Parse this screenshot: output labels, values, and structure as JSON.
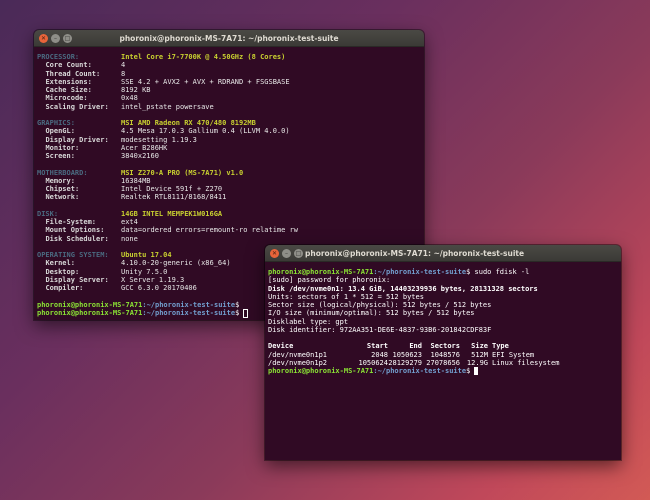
{
  "window1": {
    "title": "phoronix@phoronix-MS-7A71: ~/phoronix-test-suite",
    "sections": [
      {
        "label": "PROCESSOR:",
        "value": "Intel Core i7-7700K @ 4.50GHz (8 Cores)",
        "items": [
          {
            "key": "Core Count:",
            "value": "4"
          },
          {
            "key": "Thread Count:",
            "value": "8"
          },
          {
            "key": "Extensions:",
            "value": "SSE 4.2 + AVX2 + AVX + RDRAND + FSGSBASE"
          },
          {
            "key": "Cache Size:",
            "value": "8192 KB"
          },
          {
            "key": "Microcode:",
            "value": "0x48"
          },
          {
            "key": "Scaling Driver:",
            "value": "intel_pstate powersave"
          }
        ]
      },
      {
        "label": "GRAPHICS:",
        "value": "MSI AMD Radeon RX 470/480 8192MB",
        "items": [
          {
            "key": "OpenGL:",
            "value": "4.5 Mesa 17.0.3 Gallium 0.4 (LLVM 4.0.0)"
          },
          {
            "key": "Display Driver:",
            "value": "modesetting 1.19.3"
          },
          {
            "key": "Monitor:",
            "value": "Acer B286HK"
          },
          {
            "key": "Screen:",
            "value": "3840x2160"
          }
        ]
      },
      {
        "label": "MOTHERBOARD:",
        "value": "MSI Z270-A PRO (MS-7A71) v1.0",
        "items": [
          {
            "key": "Memory:",
            "value": "16384MB"
          },
          {
            "key": "Chipset:",
            "value": "Intel Device 591f + Z270"
          },
          {
            "key": "Network:",
            "value": "Realtek RTL8111/8168/8411"
          }
        ]
      },
      {
        "label": "DISK:",
        "value": "14GB INTEL MEMPEK1W016GA",
        "items": [
          {
            "key": "File-System:",
            "value": "ext4"
          },
          {
            "key": "Mount Options:",
            "value": "data=ordered errors=remount-ro relatime rw"
          },
          {
            "key": "Disk Scheduler:",
            "value": "none"
          }
        ]
      },
      {
        "label": "OPERATING SYSTEM:",
        "value": "Ubuntu 17.04",
        "items": [
          {
            "key": "Kernel:",
            "value": "4.10.0-20-generic (x86_64)"
          },
          {
            "key": "Desktop:",
            "value": "Unity 7.5.0"
          },
          {
            "key": "Display Server:",
            "value": "X Server 1.19.3"
          },
          {
            "key": "Compiler:",
            "value": "GCC 6.3.0 20170406"
          }
        ]
      }
    ],
    "prompt_user": "phoronix@phoronix-MS-7A71",
    "prompt_path": ":~/phoronix-test-suite",
    "prompt_symbol": "$"
  },
  "window2": {
    "title": "phoronix@phoronix-MS-7A71: ~/phoronix-test-suite",
    "prompt_user": "phoronix@phoronix-MS-7A71",
    "prompt_path": ":~/phoronix-test-suite",
    "prompt_symbol": "$",
    "command": " sudo fdisk -l",
    "lines": [
      {
        "text": "[sudo] password for phoronix:",
        "bold": false
      },
      {
        "text": "Disk /dev/nvme0n1: 13.4 GiB, 14403239936 bytes, 28131328 sectors",
        "bold": true
      },
      {
        "text": "Units: sectors of 1 * 512 = 512 bytes",
        "bold": false
      },
      {
        "text": "Sector size (logical/physical): 512 bytes / 512 bytes",
        "bold": false
      },
      {
        "text": "I/O size (minimum/optimal): 512 bytes / 512 bytes",
        "bold": false
      },
      {
        "text": "Disklabel type: gpt",
        "bold": false
      },
      {
        "text": "Disk identifier: 972AA351-DE6E-4837-93B6-201842CDF83F",
        "bold": false
      }
    ],
    "table_header": [
      "Device",
      "Start",
      "End",
      "Sectors",
      "Size",
      "Type"
    ],
    "table_rows": [
      [
        "/dev/nvme0n1p1",
        "2048",
        "1050623",
        "1048576",
        "512M",
        "EFI System"
      ],
      [
        "/dev/nvme0n1p2",
        "1050624",
        "28129279",
        "27078656",
        "12.9G",
        "Linux filesystem"
      ]
    ]
  },
  "colors": {
    "terminal_bg": "#300a24",
    "prompt_user": "#8ae234",
    "prompt_path": "#729fcf",
    "section_label": "#4a6a80",
    "section_value": "#c8d030",
    "close_button": "#e9643a"
  }
}
